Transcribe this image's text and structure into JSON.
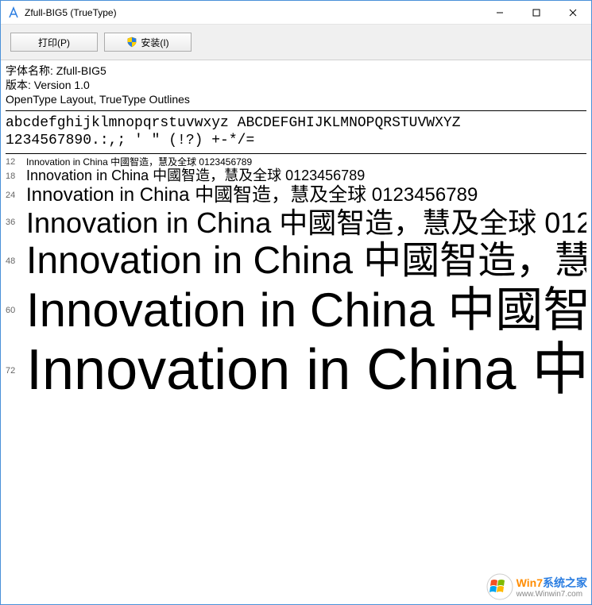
{
  "window": {
    "title": "Zfull-BIG5 (TrueType)"
  },
  "toolbar": {
    "print_label": "打印(P)",
    "install_label": "安装(I)"
  },
  "meta": {
    "name_label": "字体名称:",
    "name_value": "Zfull-BIG5",
    "version_label": "版本:",
    "version_value": "Version 1.0",
    "tech": "OpenType Layout, TrueType Outlines"
  },
  "charset": {
    "line1": "abcdefghijklmnopqrstuvwxyz ABCDEFGHIJKLMNOPQRSTUVWXYZ",
    "line2": "1234567890.:,; ' \" (!?) +-*/="
  },
  "sample_text": "Innovation in China 中國智造，慧及全球 0123456789",
  "samples": [
    {
      "size": 12
    },
    {
      "size": 18
    },
    {
      "size": 24
    },
    {
      "size": 36
    },
    {
      "size": 48
    },
    {
      "size": 60
    },
    {
      "size": 72
    }
  ],
  "watermark": {
    "brand1": "Win7",
    "brand2": "系统之家",
    "url": "www.Winwin7.com"
  }
}
